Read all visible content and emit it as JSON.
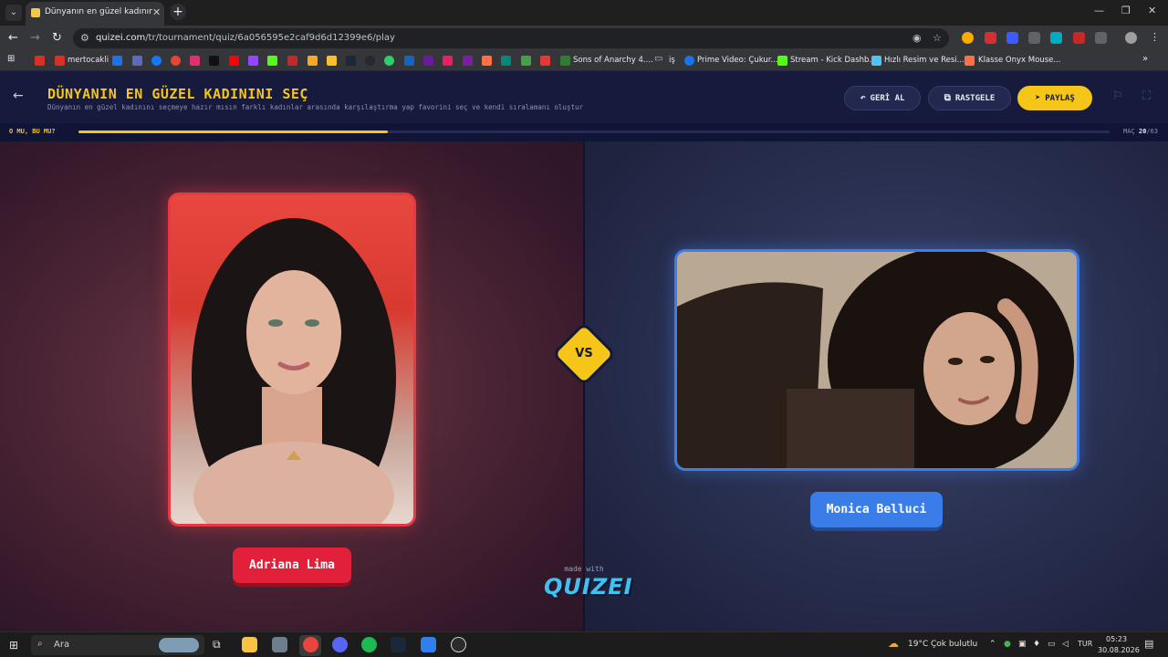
{
  "browser": {
    "tab_title": "Dünyanın en güzel kadınını seç",
    "url_host": "quizei.com",
    "url_path": "/tr/tournament/quiz/6a056595e2caf9d6d12399e6/play",
    "bookmarks": [
      {
        "label": "mertocakli",
        "color": "#d93025"
      },
      {
        "label": "Sons of Anarchy 4....",
        "color": "#2e7d32"
      },
      {
        "label": "iş",
        "color": "#9aa0a6"
      },
      {
        "label": "Prime Video: Çukur...",
        "color": "#1a73e8"
      },
      {
        "label": "Stream - Kick Dashb...",
        "color": "#53fc18"
      },
      {
        "label": "Hızlı Resim ve Resi...",
        "color": "#4fc3f7"
      },
      {
        "label": "Klasse Onyx Mouse...",
        "color": "#ff7043"
      }
    ]
  },
  "header": {
    "title": "DÜNYANIN EN GÜZEL KADININI SEÇ",
    "subtitle": "Dünyanın en güzel kadınını seçmeye hazır mısın farklı kadınlar arasında karşılaştırma yap favorini seç ve kendi sıralamanı oluştur",
    "undo_label": "GERİ AL",
    "random_label": "RASTGELE",
    "share_label": "PAYLAŞ"
  },
  "progress": {
    "label": "O MU, BU MU?",
    "match_prefix": "MAÇ",
    "current": "20",
    "total": "/63",
    "fraction": 0.3
  },
  "arena": {
    "left_name": "Adriana Lima",
    "right_name": "Monica Belluci",
    "vs": "VS",
    "made_with": "made with",
    "brand": "QUIZEI",
    "colors": {
      "left": "#e2203a",
      "right": "#3a7de8",
      "accent": "#f5c518"
    }
  },
  "taskbar": {
    "search_placeholder": "Ara",
    "weather_temp": "19°C",
    "weather_text": "Çok bulutlu",
    "lang": "TUR",
    "time": "05:23",
    "date": "30.08.2026"
  }
}
